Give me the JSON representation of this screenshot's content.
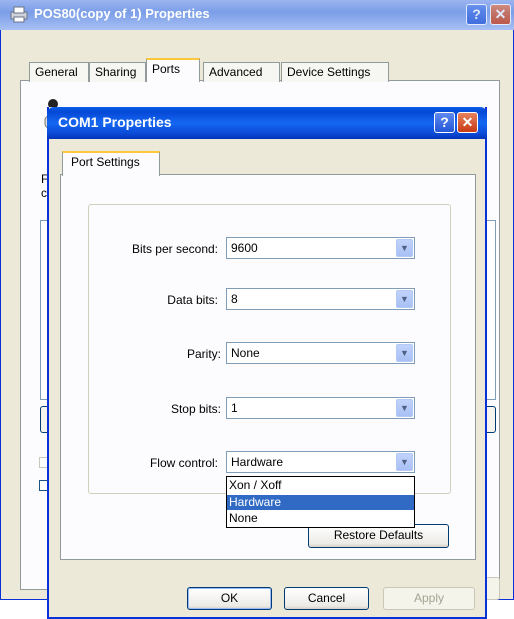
{
  "back_window": {
    "title": "POS80(copy of 1) Properties",
    "tabs": [
      "General",
      "Sharing",
      "Ports",
      "Advanced",
      "Device Settings"
    ],
    "active_tab": "Ports",
    "partial_text_1": "F",
    "partial_text_2": "c",
    "help_glyph": "?",
    "close_glyph": "✕"
  },
  "dialog": {
    "title": "COM1 Properties",
    "tab": "Port Settings",
    "help_glyph": "?",
    "close_glyph": "✕",
    "fields": {
      "bits_per_second": {
        "label": "Bits per second:",
        "value": "9600"
      },
      "data_bits": {
        "label": "Data bits:",
        "value": "8"
      },
      "parity": {
        "label": "Parity:",
        "value": "None"
      },
      "stop_bits": {
        "label": "Stop bits:",
        "value": "1"
      },
      "flow_control": {
        "label": "Flow control:",
        "value": "Hardware"
      }
    },
    "flow_control_options": [
      {
        "label": "Xon / Xoff",
        "selected": false
      },
      {
        "label": "Hardware",
        "selected": true
      },
      {
        "label": "None",
        "selected": false
      }
    ],
    "restore_defaults_label": "Restore Defaults",
    "ok_label": "OK",
    "cancel_label": "Cancel",
    "apply_label": "Apply"
  },
  "icons": {
    "combo_arrow": "chevron-down-icon",
    "printer": "printer-icon"
  },
  "colors": {
    "title_blue": "#0a5ee6",
    "selection": "#316ac5",
    "dialog_bg": "#ece9d8"
  }
}
